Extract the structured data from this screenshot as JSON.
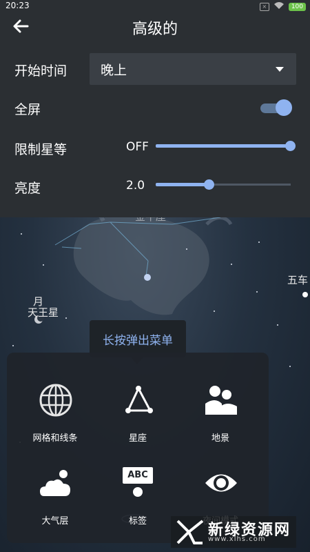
{
  "status_bar": {
    "time": "20:23",
    "battery": "100",
    "sim": "×"
  },
  "header": {
    "title": "高级的"
  },
  "settings": {
    "start_time": {
      "label": "开始时间",
      "value": "晚上"
    },
    "fullscreen": {
      "label": "全屏",
      "on": true
    },
    "limit_magnitude": {
      "label": "限制星等",
      "value": "OFF",
      "level": 1.0
    },
    "brightness": {
      "label": "亮度",
      "value": "2.0",
      "level": 0.4
    }
  },
  "sky_labels": {
    "taurus_partial": "金牛座",
    "moon": "月",
    "uranus": "天王星",
    "capella": "五车"
  },
  "tooltip": {
    "text": "长按弹出菜单"
  },
  "menu": {
    "grid": "网格和线条",
    "constellations": "星座",
    "landscape": "地景",
    "atmosphere": "大气层",
    "labels": "标签",
    "labels_icon_text": "ABC",
    "night_mode": "夜间模式"
  },
  "watermark": {
    "title": "新绿资源网",
    "url": "www.xlhs.com"
  },
  "colors": {
    "accent": "#8fb3f0",
    "panel": "#2b2f33"
  }
}
